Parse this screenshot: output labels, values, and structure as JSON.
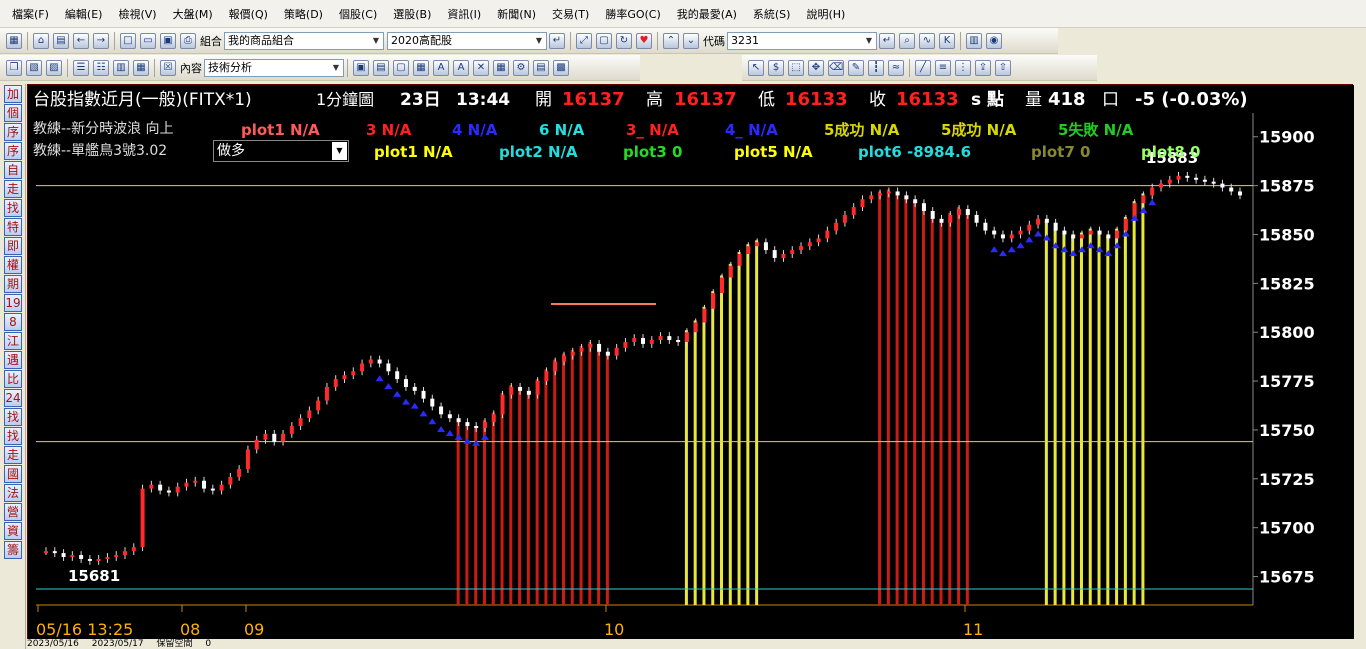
{
  "menu": [
    "檔案(F)",
    "編輯(E)",
    "檢視(V)",
    "大盤(M)",
    "報價(Q)",
    "策略(D)",
    "個股(C)",
    "選股(B)",
    "資訊(I)",
    "新聞(N)",
    "交易(T)",
    "勝率GO(C)",
    "我的最愛(A)",
    "系統(S)",
    "說明(H)"
  ],
  "toolbar": {
    "group_label": "組合",
    "group_value": "我的商品組合",
    "list_value": "2020高配股",
    "code_label": "代碼",
    "code_value": "3231",
    "content_label": "內容",
    "content_value": "技術分析"
  },
  "left_strip": [
    "加",
    "個",
    "序",
    "序",
    "自",
    "走",
    "找",
    "特",
    "即",
    "權",
    "期",
    "19",
    "8",
    "江",
    "遇",
    "比",
    "24",
    "找",
    "找",
    "走",
    "國",
    "法",
    "營",
    "資",
    "籌"
  ],
  "header": {
    "title": "台股指數近月(一般)(FITX*1)",
    "period": "1分鐘圖",
    "day": "23日",
    "time": "13:44",
    "open_label": "開",
    "open": "16137",
    "high_label": "高",
    "high": "16137",
    "low_label": "低",
    "low": "16133",
    "close_label": "收",
    "close": "16133",
    "unit": "s 點",
    "vol_label": "量",
    "vol": "418",
    "vol_unit": "口",
    "change": "-5 (-0.03%)"
  },
  "indicators": {
    "row1_name": "教練--新分時波浪 向上",
    "row1": [
      {
        "text": "plot1 N/A",
        "color": "#ff5a5a"
      },
      {
        "text": "3 N/A",
        "color": "#ff2020"
      },
      {
        "text": "4 N/A",
        "color": "#2a2aff"
      },
      {
        "text": "6 N/A",
        "color": "#22e0e0"
      },
      {
        "text": "3_ N/A",
        "color": "#ff2020"
      },
      {
        "text": "4_ N/A",
        "color": "#2a2aff"
      },
      {
        "text": "5成功 N/A",
        "color": "#d8d800"
      },
      {
        "text": "5成功 N/A",
        "color": "#d8d800"
      },
      {
        "text": "5失敗 N/A",
        "color": "#22cc22"
      }
    ],
    "row2_name": "教練--單艦鳥3號3.02",
    "row2_select": "做多",
    "row2": [
      {
        "text": "plot1 N/A",
        "color": "#ffff00"
      },
      {
        "text": "plot2 N/A",
        "color": "#22dddd"
      },
      {
        "text": "plot3 0",
        "color": "#22dd22"
      },
      {
        "text": "plot5 N/A",
        "color": "#ffff00"
      },
      {
        "text": "plot6 -8984.6",
        "color": "#22dddd"
      },
      {
        "text": "plot7 0",
        "color": "#888833"
      },
      {
        "text": "plot8 0",
        "color": "#99ff66"
      }
    ]
  },
  "chart_data": {
    "type": "candlestick",
    "y_axis_ticks": [
      "15900",
      "15875",
      "15850",
      "15825",
      "15800",
      "15775",
      "15750",
      "15725",
      "15700",
      "15675"
    ],
    "ylim": [
      15663,
      15906
    ],
    "x_axis_labels": [
      "05/16 13:25",
      "08",
      "09",
      "10",
      "11"
    ],
    "annotations": {
      "low_label": "15681",
      "high_label": "15883"
    },
    "horizontal_lines": [
      15744,
      15875
    ],
    "red_zones": [
      [
        "09:08",
        "09:40"
      ],
      [
        "10:40",
        "10:59"
      ]
    ],
    "yellow_zones": [
      [
        "09:57",
        "10:12"
      ],
      [
        "11:15",
        "11:36"
      ]
    ],
    "close_path": [
      15688,
      15687,
      15685,
      15686,
      15684,
      15683,
      15684,
      15685,
      15686,
      15688,
      15690,
      15720,
      15722,
      15719,
      15718,
      15721,
      15723,
      15724,
      15720,
      15719,
      15722,
      15726,
      15730,
      15740,
      15745,
      15748,
      15744,
      15748,
      15752,
      15756,
      15760,
      15765,
      15772,
      15776,
      15778,
      15780,
      15784,
      15786,
      15784,
      15780,
      15776,
      15772,
      15770,
      15766,
      15762,
      15758,
      15756,
      15754,
      15752,
      15751,
      15754,
      15758,
      15768,
      15772,
      15770,
      15768,
      15775,
      15780,
      15785,
      15788,
      15790,
      15792,
      15794,
      15790,
      15788,
      15792,
      15795,
      15797,
      15794,
      15796,
      15798,
      15796,
      15795,
      15800,
      15805,
      15812,
      15820,
      15828,
      15834,
      15840,
      15844,
      15846,
      15842,
      15838,
      15840,
      15842,
      15844,
      15846,
      15848,
      15852,
      15856,
      15860,
      15864,
      15868,
      15870,
      15871,
      15872,
      15870,
      15868,
      15866,
      15862,
      15858,
      15856,
      15860,
      15863,
      15860,
      15856,
      15852,
      15850,
      15848,
      15850,
      15852,
      15855,
      15858,
      15856,
      15852,
      15850,
      15848,
      15850,
      15852,
      15850,
      15848,
      15852,
      15858,
      15866,
      15870,
      15874,
      15876,
      15878,
      15880,
      15879,
      15878,
      15877,
      15876,
      15874,
      15872,
      15870
    ]
  },
  "status": {
    "from": "2023/05/16",
    "to": "2023/05/17",
    "keep": "保留空間",
    "spin": "0"
  }
}
